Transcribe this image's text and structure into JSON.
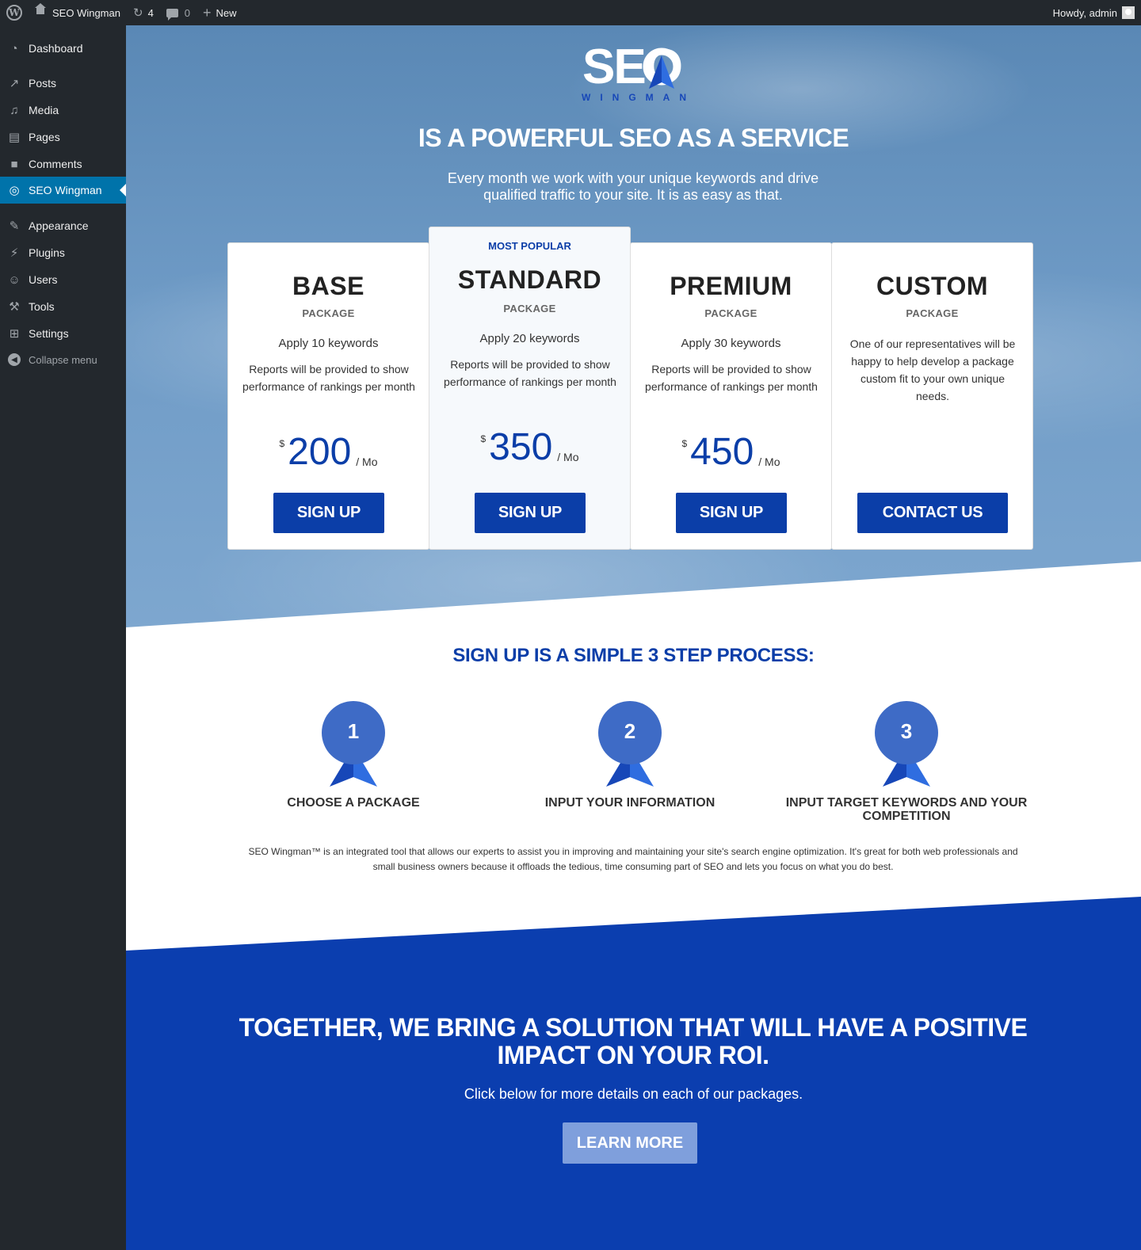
{
  "admin_bar": {
    "site_name": "SEO Wingman",
    "updates_count": "4",
    "comments_count": "0",
    "new_label": "New",
    "greeting": "Howdy, admin"
  },
  "sidebar": {
    "items": [
      {
        "label": "Dashboard",
        "icon": "dashboard-icon"
      },
      {
        "label": "Posts",
        "icon": "pin-icon"
      },
      {
        "label": "Media",
        "icon": "media-icon"
      },
      {
        "label": "Pages",
        "icon": "pages-icon"
      },
      {
        "label": "Comments",
        "icon": "comment-icon"
      },
      {
        "label": "SEO Wingman",
        "icon": "wingman-icon"
      },
      {
        "label": "Appearance",
        "icon": "brush-icon"
      },
      {
        "label": "Plugins",
        "icon": "plug-icon"
      },
      {
        "label": "Users",
        "icon": "user-icon"
      },
      {
        "label": "Tools",
        "icon": "wrench-icon"
      },
      {
        "label": "Settings",
        "icon": "settings-icon"
      }
    ],
    "collapse_label": "Collapse menu",
    "active_item": "SEO Wingman"
  },
  "logo": {
    "word": "SEO",
    "tagline": "WINGMAN"
  },
  "hero": {
    "title": "IS A POWERFUL SEO AS A SERVICE",
    "subtitle": "Every month we work with your unique keywords and drive qualified traffic to your site. It is as easy as that."
  },
  "pricing": {
    "popular_badge": "MOST POPULAR",
    "package_label": "PACKAGE",
    "cards": [
      {
        "name": "BASE",
        "keywords": "Apply 10 keywords",
        "description": "Reports will be provided to show performance of rankings per month",
        "currency": "$",
        "price": "200",
        "period": "/ Mo",
        "button": "SIGN UP"
      },
      {
        "name": "STANDARD",
        "keywords": "Apply 20 keywords",
        "description": "Reports will be provided to show performance of rankings per month",
        "currency": "$",
        "price": "350",
        "period": "/ Mo",
        "button": "SIGN UP"
      },
      {
        "name": "PREMIUM",
        "keywords": "Apply 30 keywords",
        "description": "Reports will be provided to show performance of rankings per month",
        "currency": "$",
        "price": "450",
        "period": "/ Mo",
        "button": "SIGN UP"
      },
      {
        "name": "CUSTOM",
        "description": "One of our representatives will be happy to help develop a package custom fit to your own unique needs.",
        "button": "CONTACT US"
      }
    ]
  },
  "steps": {
    "title": "SIGN UP IS A SIMPLE 3 STEP PROCESS:",
    "items": [
      {
        "number": "1",
        "label": "CHOOSE A PACKAGE"
      },
      {
        "number": "2",
        "label": "INPUT YOUR INFORMATION"
      },
      {
        "number": "3",
        "label": "INPUT TARGET KEYWORDS AND YOUR COMPETITION"
      }
    ],
    "about": "SEO Wingman™ is an integrated tool that allows our experts to assist you in improving and maintaining your site's search engine optimization. It's great for both web professionals and small business owners because it offloads the tedious, time consuming part of SEO and lets you focus on what you do best."
  },
  "cta": {
    "title": "TOGETHER, WE BRING A SOLUTION THAT WILL HAVE A POSITIVE IMPACT ON YOUR ROI.",
    "subtitle": "Click below for more details on each of our packages.",
    "button": "LEARN MORE"
  },
  "colors": {
    "brand_blue": "#0b3ea8",
    "step_circle": "#3e6bc6",
    "wp_active": "#0073aa",
    "learn_button": "#7f9fdc"
  }
}
